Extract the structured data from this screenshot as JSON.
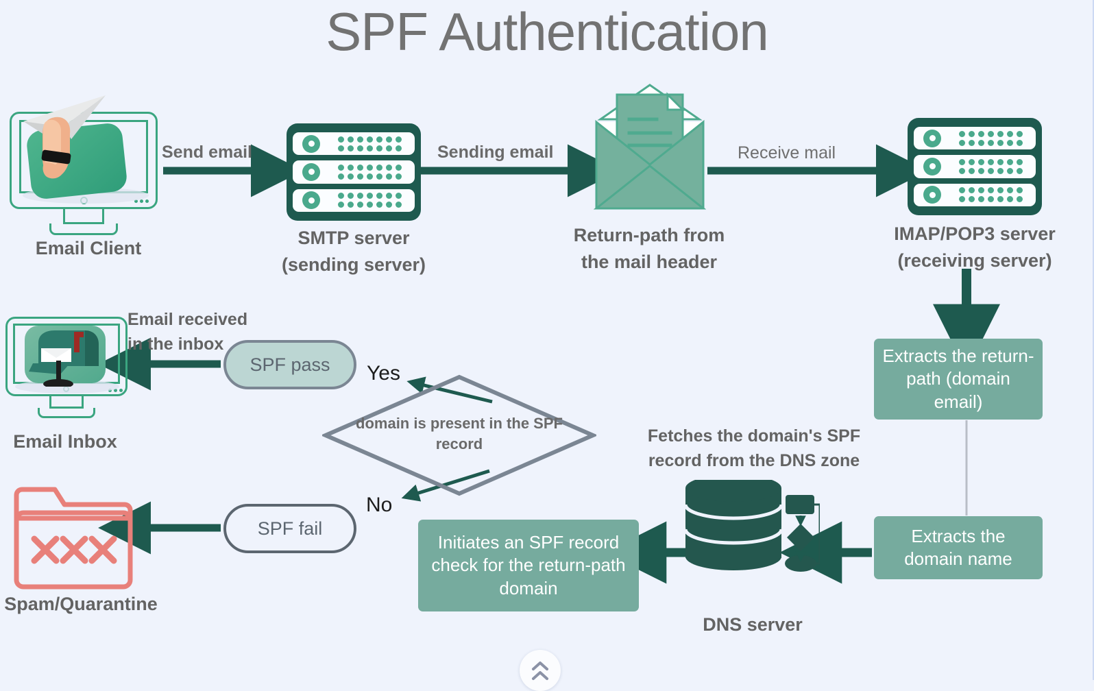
{
  "title": "SPF Authentication",
  "colors": {
    "background": "#eff3fc",
    "dark_teal": "#1e5a4f",
    "medium_green": "#76ab9e",
    "light_green": "#5bab8e",
    "pill_pass_fill": "#bcd6d3",
    "gray_stroke": "#7b8693",
    "red": "#e8807a",
    "title_gray": "#727272"
  },
  "nodes": {
    "email_client": {
      "label": "Email Client",
      "icon": "monitor-paper-plane-icon"
    },
    "smtp_server": {
      "label": "SMTP server\n(sending server)",
      "line1": "SMTP server",
      "line2": "(sending server)",
      "icon": "server-rack-icon"
    },
    "return_path": {
      "line1": "Return-path from",
      "line2": "the mail header",
      "icon": "open-envelope-icon"
    },
    "imap_server": {
      "line1": "IMAP/POP3 server",
      "line2": "(receiving server)",
      "icon": "server-rack-icon"
    },
    "email_inbox": {
      "label": "Email Inbox",
      "icon": "monitor-mailbox-icon"
    },
    "spam_quarantine": {
      "label": "Spam/Quarantine",
      "icon": "folder-x-icon"
    },
    "dns_server": {
      "label": "DNS server",
      "icon": "database-flowchart-icon"
    },
    "extract_return_path": {
      "text": "Extracts the return-path (domain email)"
    },
    "extract_domain_name": {
      "text": "Extracts the domain name"
    },
    "initiate_spf_check": {
      "text": "Initiates an SPF record check for the return-path domain"
    },
    "spf_pass": {
      "label": "SPF pass"
    },
    "spf_fail": {
      "label": "SPF fail"
    },
    "decision": {
      "text": "domain is present in the SPF record"
    }
  },
  "edges": {
    "send_email": "Send email",
    "sending_email": "Sending email",
    "receive_mail": "Receive mail",
    "email_received": {
      "line1": "Email received",
      "line2": "in the inbox"
    },
    "fetches_spf": {
      "line1": "Fetches the domain's SPF",
      "line2": "record from the DNS zone"
    },
    "yes": "Yes",
    "no": "No"
  },
  "controls": {
    "scroll_top": {
      "name": "scroll-to-top",
      "glyph": "chevron-up"
    }
  }
}
